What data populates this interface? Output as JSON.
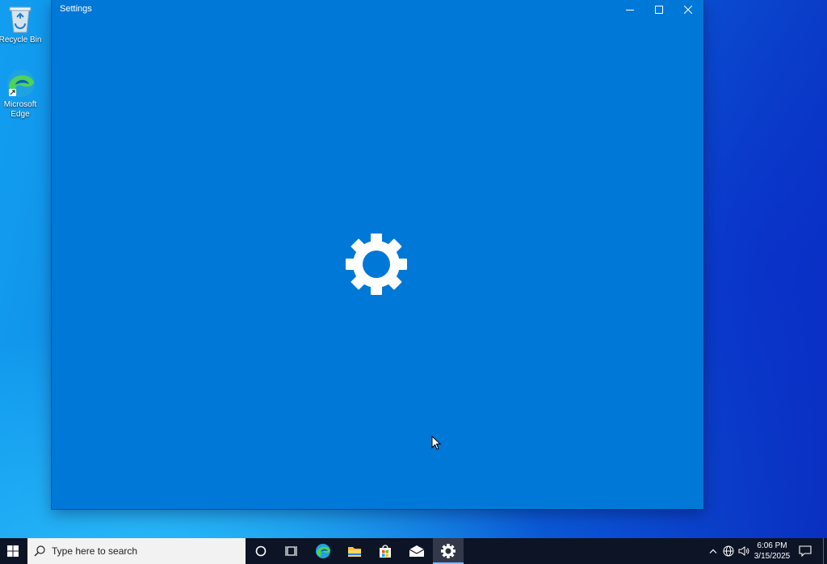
{
  "desktop": {
    "icons": [
      {
        "label": "Recycle Bin",
        "icon": "recycle-bin-icon"
      },
      {
        "label": "Microsoft Edge",
        "icon": "edge-icon"
      }
    ]
  },
  "window": {
    "title": "Settings",
    "accent": "#0078d7",
    "controls": {
      "minimize": "minimize-icon",
      "maximize": "maximize-icon",
      "close": "close-icon"
    },
    "splash_icon": "gear-icon"
  },
  "taskbar": {
    "background": "#0c1426",
    "search_placeholder": "Type here to search",
    "pinned": [
      {
        "name": "cortana",
        "icon": "circle-icon"
      },
      {
        "name": "task-view",
        "icon": "task-view-icon"
      },
      {
        "name": "edge",
        "icon": "edge-icon"
      },
      {
        "name": "file-explorer",
        "icon": "folder-icon"
      },
      {
        "name": "store",
        "icon": "store-icon"
      },
      {
        "name": "mail",
        "icon": "mail-icon"
      },
      {
        "name": "settings",
        "icon": "gear-icon",
        "active": true
      }
    ],
    "tray": {
      "time": "6:06 PM",
      "date": "3/15/2025",
      "icons": [
        "chevron-up-icon",
        "network-globe-icon",
        "volume-icon",
        "notification-icon"
      ]
    }
  }
}
